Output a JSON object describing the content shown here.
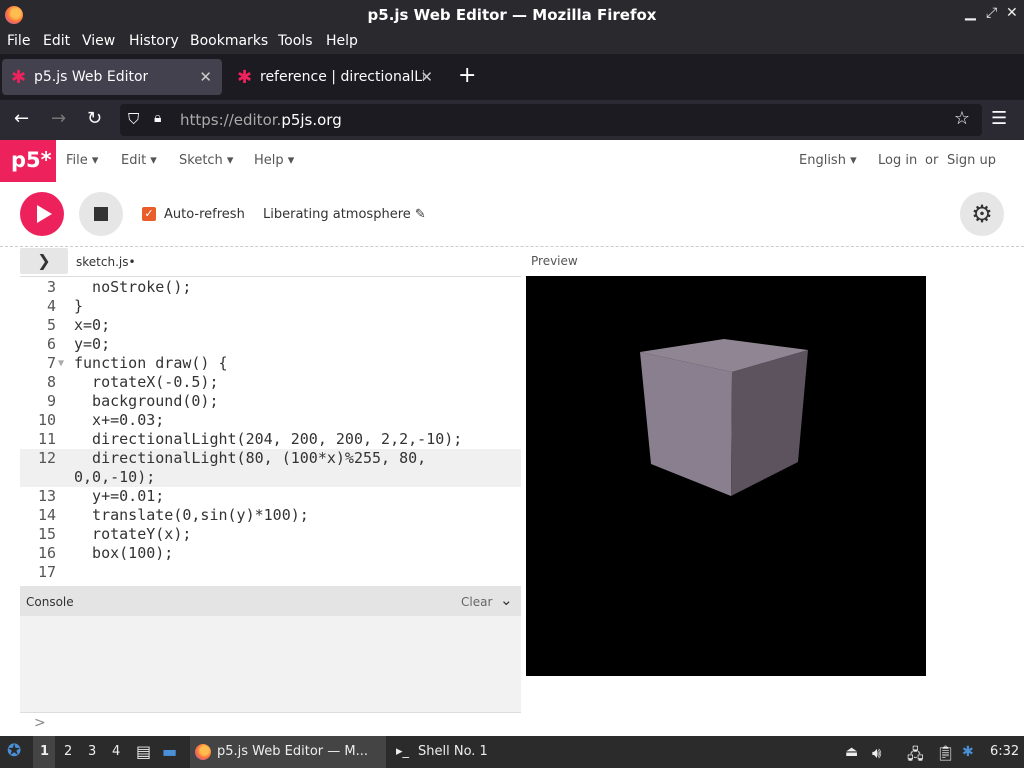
{
  "window": {
    "title": "p5.js Web Editor — Mozilla Firefox"
  },
  "firefox_menu": [
    "File",
    "Edit",
    "View",
    "History",
    "Bookmarks",
    "Tools",
    "Help"
  ],
  "tabs": [
    {
      "label": "p5.js Web Editor",
      "active": true
    },
    {
      "label": "reference | directionalLig",
      "active": false
    }
  ],
  "navbar": {
    "url_prefix": "https://editor.",
    "url_domain": "p5js.org"
  },
  "p5_menu": {
    "logo": "p5*",
    "items": [
      "File ▾",
      "Edit ▾",
      "Sketch ▾",
      "Help ▾"
    ],
    "language": "English ▾",
    "login": "Log in",
    "or": "or",
    "signup": "Sign up"
  },
  "toolbar": {
    "auto_refresh_label": "Auto-refresh",
    "auto_refresh_checked": true,
    "sketch_name": "Liberating atmosphere ✎"
  },
  "editor": {
    "filename": "sketch.js",
    "unsaved_dot": "•",
    "lines": [
      {
        "num": "3",
        "text": "  noStroke();"
      },
      {
        "num": "4",
        "text": "}"
      },
      {
        "num": "5",
        "text": "x=0;"
      },
      {
        "num": "6",
        "text": "y=0;"
      },
      {
        "num": "7",
        "text": "function draw() {"
      },
      {
        "num": "8",
        "text": "  rotateX(-0.5);"
      },
      {
        "num": "9",
        "text": "  background(0);"
      },
      {
        "num": "10",
        "text": "  x+=0.03;"
      },
      {
        "num": "11",
        "text": "  directionalLight(204, 200, 200, 2,2,-10);"
      },
      {
        "num": "12",
        "text": "  directionalLight(80, (100*x)%255, 80,"
      },
      {
        "num": "",
        "text": "0,0,-10);"
      },
      {
        "num": "13",
        "text": "  y+=0.01;"
      },
      {
        "num": "14",
        "text": "  translate(0,sin(y)*100);"
      },
      {
        "num": "15",
        "text": "  rotateY(x);"
      },
      {
        "num": "16",
        "text": "  box(100);"
      },
      {
        "num": "17",
        "text": ""
      }
    ]
  },
  "console": {
    "label": "Console",
    "clear": "Clear",
    "prompt": ">"
  },
  "preview": {
    "label": "Preview",
    "cube_color": "#8c8290"
  },
  "taskbar": {
    "workspaces": [
      "1",
      "2",
      "3",
      "4"
    ],
    "active_workspace": "1",
    "firefox_task": "p5.js Web Editor — M...",
    "shell_task": "Shell No. 1",
    "clock": "6:32"
  }
}
